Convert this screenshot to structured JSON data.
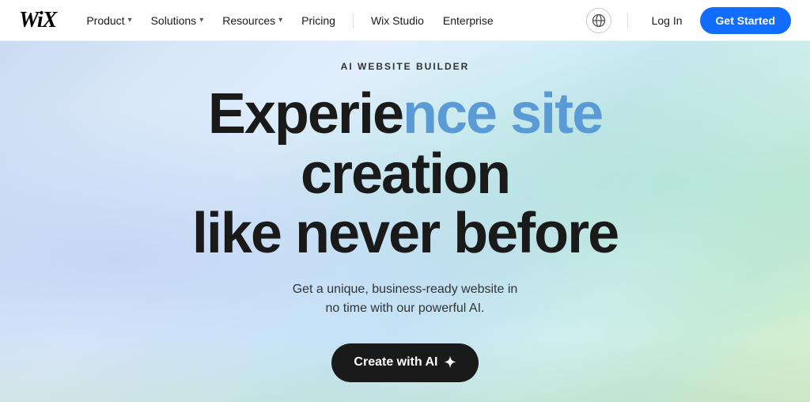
{
  "navbar": {
    "logo": "WiX",
    "links": [
      {
        "label": "Product",
        "hasDropdown": true
      },
      {
        "label": "Solutions",
        "hasDropdown": true
      },
      {
        "label": "Resources",
        "hasDropdown": true
      },
      {
        "label": "Pricing",
        "hasDropdown": false
      },
      {
        "label": "Wix Studio",
        "hasDropdown": false
      },
      {
        "label": "Enterprise",
        "hasDropdown": false
      }
    ],
    "login_label": "Log In",
    "cta_label": "Get Started",
    "globe_icon": "🌐"
  },
  "hero": {
    "eyebrow": "AI WEBSITE BUILDER",
    "headline_part1": "Experie",
    "headline_highlight": "nce site",
    "headline_part2": " creation",
    "headline_line2": "like never before",
    "subtext_line1": "Get a unique, business-ready website in",
    "subtext_line2": "no time with our powerful AI.",
    "cta_label": "Create with AI",
    "sparkle_icon": "✦"
  },
  "colors": {
    "nav_cta_bg": "#116dff",
    "hero_cta_bg": "#1a1a1a",
    "headline_highlight": "#5b9bd5"
  }
}
